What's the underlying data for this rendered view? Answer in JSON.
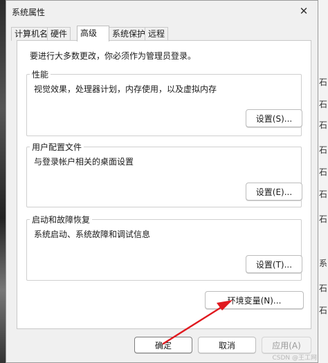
{
  "window": {
    "title": "系统属性",
    "close_glyph": "✕"
  },
  "tabs": [
    {
      "label": "计算机名",
      "active": false
    },
    {
      "label": "硬件",
      "active": false
    },
    {
      "label": "高级",
      "active": true
    },
    {
      "label": "系统保护",
      "active": false
    },
    {
      "label": "远程",
      "active": false
    }
  ],
  "notice": "要进行大多数更改，你必须作为管理员登录。",
  "groups": {
    "performance": {
      "title": "性能",
      "description": "视觉效果，处理器计划，内存使用，以及虚拟内存",
      "button": "设置(S)..."
    },
    "user_profiles": {
      "title": "用户配置文件",
      "description": "与登录帐户相关的桌面设置",
      "button": "设置(E)..."
    },
    "startup_recovery": {
      "title": "启动和故障恢复",
      "description": "系统启动、系统故障和调试信息",
      "button": "设置(T)..."
    }
  },
  "env_button": "环境变量(N)...",
  "footer": {
    "ok": "确定",
    "cancel": "取消",
    "apply": "应用(A)"
  },
  "annotation_arrow_color": "#e0191f",
  "background_right_glyphs": [
    "石",
    "石",
    "石",
    "石",
    "石",
    "石",
    "石",
    "系",
    "石",
    "石"
  ],
  "watermark": "CSDN @王工网"
}
